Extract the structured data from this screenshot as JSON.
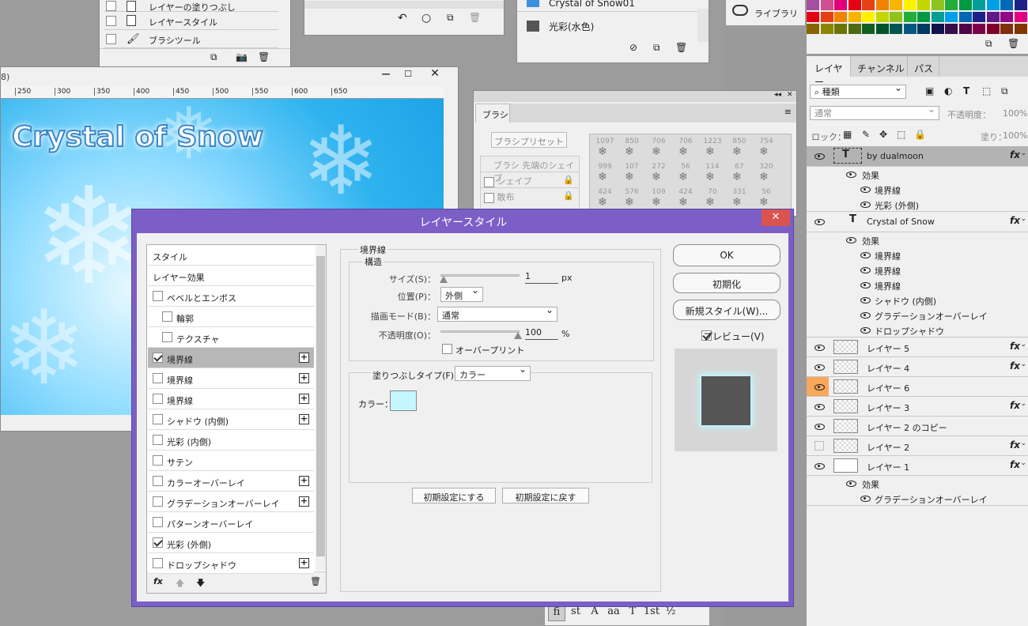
{
  "history_panel": {
    "items": [
      "レイヤーの塗りつぶし",
      "レイヤースタイル",
      "ブラシツール"
    ]
  },
  "library": {
    "label": "ライブラリ"
  },
  "swatch_panel": {
    "items": [
      "Crystal of Snow01",
      "光彩(水色)"
    ]
  },
  "colors": {
    "accent": "#7b5fc6",
    "close": "#d9534f",
    "swatch": "#c4f6ff",
    "highlight": "#f7a85a"
  },
  "document": {
    "title_fragment": "8)",
    "ruler": [
      "250",
      "300",
      "350",
      "400",
      "450",
      "500",
      "550",
      "600",
      "650"
    ],
    "logo_text": "Crystal of Snow"
  },
  "brush_panel": {
    "tab": "ブラシ",
    "preset_button": "ブラシプリセット",
    "items": [
      "ブラシ 先端のシェイプ",
      "シェイプ",
      "散布"
    ],
    "sizes": [
      [
        "1097",
        "850",
        "706",
        "706",
        "1223",
        "850",
        "754"
      ],
      [
        "999",
        "107",
        "272",
        "56",
        "114",
        "67",
        "320"
      ],
      [
        "424",
        "576",
        "109",
        "424",
        "70",
        "331",
        "56"
      ]
    ]
  },
  "char_toolbar": [
    "fi",
    "st",
    "A",
    "aa",
    "T",
    "1st",
    "½"
  ],
  "layers_panel": {
    "tabs": [
      "レイヤー",
      "チャンネル",
      "パス"
    ],
    "kind_placeholder": "種類",
    "blend_mode": "通常",
    "opacity_label": "不透明度：",
    "opacity_value": "100%",
    "lock_label": "ロック：",
    "fill_label": "塗り：",
    "fill_value": "100%",
    "layers": [
      {
        "name": "by dualmoon",
        "type": "text",
        "fx": true,
        "effects_label": "効果",
        "effects": [
          "境界線",
          "光彩 (外側)"
        ]
      },
      {
        "name": "Crystal of Snow",
        "type": "text",
        "fx": true,
        "effects_label": "効果",
        "effects": [
          "境界線",
          "境界線",
          "境界線",
          "シャドウ (内側)",
          "グラデーションオーバーレイ",
          "ドロップシャドウ"
        ]
      },
      {
        "name": "レイヤー 5",
        "fx": true
      },
      {
        "name": "レイヤー 4",
        "fx": true
      },
      {
        "name": "レイヤー 6",
        "fx": false
      },
      {
        "name": "レイヤー 3",
        "fx": true
      },
      {
        "name": "レイヤー 2 のコピー",
        "fx": false
      },
      {
        "name": "レイヤー 2",
        "fx": true
      },
      {
        "name": "レイヤー 1",
        "fx": true,
        "effects_label": "効果",
        "effects": [
          "グラデーションオーバーレイ"
        ]
      }
    ]
  },
  "dialog": {
    "title": "レイヤースタイル",
    "styles_header": "スタイル",
    "effects_header": "レイヤー効果",
    "styles": [
      {
        "label": "ベベルとエンボス",
        "checked": false,
        "plus": false,
        "indent": false
      },
      {
        "label": "輪郭",
        "checked": false,
        "plus": false,
        "indent": true
      },
      {
        "label": "テクスチャ",
        "checked": false,
        "plus": false,
        "indent": true
      },
      {
        "label": "境界線",
        "checked": true,
        "plus": true,
        "selected": true
      },
      {
        "label": "境界線",
        "checked": false,
        "plus": true
      },
      {
        "label": "境界線",
        "checked": false,
        "plus": true
      },
      {
        "label": "シャドウ (内側)",
        "checked": false,
        "plus": true
      },
      {
        "label": "光彩 (内側)",
        "checked": false,
        "plus": false
      },
      {
        "label": "サテン",
        "checked": false,
        "plus": false
      },
      {
        "label": "カラーオーバーレイ",
        "checked": false,
        "plus": true
      },
      {
        "label": "グラデーションオーバーレイ",
        "checked": false,
        "plus": true
      },
      {
        "label": "パターンオーバーレイ",
        "checked": false,
        "plus": false
      },
      {
        "label": "光彩 (外側)",
        "checked": true,
        "plus": false
      },
      {
        "label": "ドロップシャドウ",
        "checked": false,
        "plus": true
      }
    ],
    "section_title": "境界線",
    "structure_title": "構造",
    "size_label": "サイズ(S)：",
    "size_value": "1",
    "size_unit": "px",
    "position_label": "位置(P)：",
    "position_value": "外側",
    "blend_label": "描画モード(B)：",
    "blend_value": "通常",
    "opacity_label": "不透明度(O)：",
    "opacity_value": "100",
    "opacity_unit": "%",
    "overprint_label": "オーバープリント",
    "fill_type_label": "塗りつぶしタイプ(F)：",
    "fill_type_value": "カラー",
    "color_label": "カラー：",
    "make_default": "初期設定にする",
    "reset_default": "初期設定に戻す",
    "ok": "OK",
    "reset": "初期化",
    "new_style": "新規スタイル(W)...",
    "preview_label": "プレビュー(V)"
  }
}
